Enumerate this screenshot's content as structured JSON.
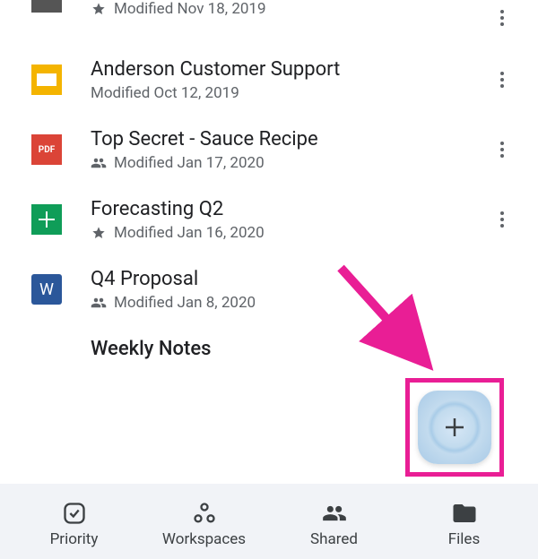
{
  "files": [
    {
      "title": "",
      "meta_icon": "star",
      "modified": "Modified Nov 18, 2019",
      "icon": "generic",
      "icon_label": ""
    },
    {
      "title": "Anderson Customer Support",
      "meta_icon": "",
      "modified": "Modified Oct 12, 2019",
      "icon": "slides",
      "icon_label": ""
    },
    {
      "title": "Top Secret - Sauce Recipe",
      "meta_icon": "shared",
      "modified": "Modified Jan 17, 2020",
      "icon": "pdf",
      "icon_label": "PDF"
    },
    {
      "title": "Forecasting Q2",
      "meta_icon": "star",
      "modified": "Modified Jan 16, 2020",
      "icon": "sheets",
      "icon_label": ""
    },
    {
      "title": "Q4 Proposal",
      "meta_icon": "shared",
      "modified": "Modified Jan 8, 2020",
      "icon": "word",
      "icon_label": "W"
    },
    {
      "title": "Weekly Notes",
      "meta_icon": "",
      "modified": "",
      "icon": "",
      "icon_label": ""
    }
  ],
  "nav": {
    "priority": "Priority",
    "workspaces": "Workspaces",
    "shared": "Shared",
    "files": "Files"
  },
  "annotation": {
    "highlight_color": "#e91e95"
  }
}
